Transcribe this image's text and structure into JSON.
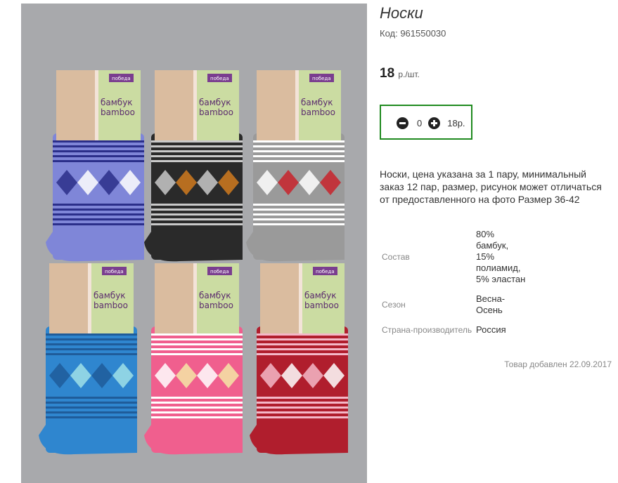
{
  "product": {
    "title": "Носки",
    "code": "Код: 961550030",
    "price": "18",
    "price_unit": "р./шт.",
    "quantity": "0",
    "sum": "18р.",
    "description": "Носки, цена указана за 1 пару, минимальный заказ 12 пар, размер, рисунок может отличаться от предоставленного на фото Размер 36-42",
    "added": "Товар добавлен 22.09.2017"
  },
  "specs": [
    {
      "label": "Состав",
      "value": "80% бамбук, 15% полиамид, 5% эластан"
    },
    {
      "label": "Сезон",
      "value": "Весна-Осень"
    },
    {
      "label": "Страна-производитель",
      "value": "Россия"
    }
  ],
  "photo": {
    "label_text": "бамбук",
    "label_text2": "bamboo",
    "brand": "победа",
    "socks": [
      {
        "color": "#7f86d8",
        "band": "#2b2f8a",
        "accent": "#ffffff"
      },
      {
        "color": "#2a2a2a",
        "band": "#c9c9c9",
        "accent": "#d07a1f"
      },
      {
        "color": "#9a9a9a",
        "band": "#ffffff",
        "accent": "#c8232b"
      },
      {
        "color": "#2f86cf",
        "band": "#1f5c9a",
        "accent": "#9fe0e8"
      },
      {
        "color": "#f05f8e",
        "band": "#ffffff",
        "accent": "#f5e6a6"
      },
      {
        "color": "#b01e2d",
        "band": "#f4b8c8",
        "accent": "#ffffff"
      }
    ]
  }
}
